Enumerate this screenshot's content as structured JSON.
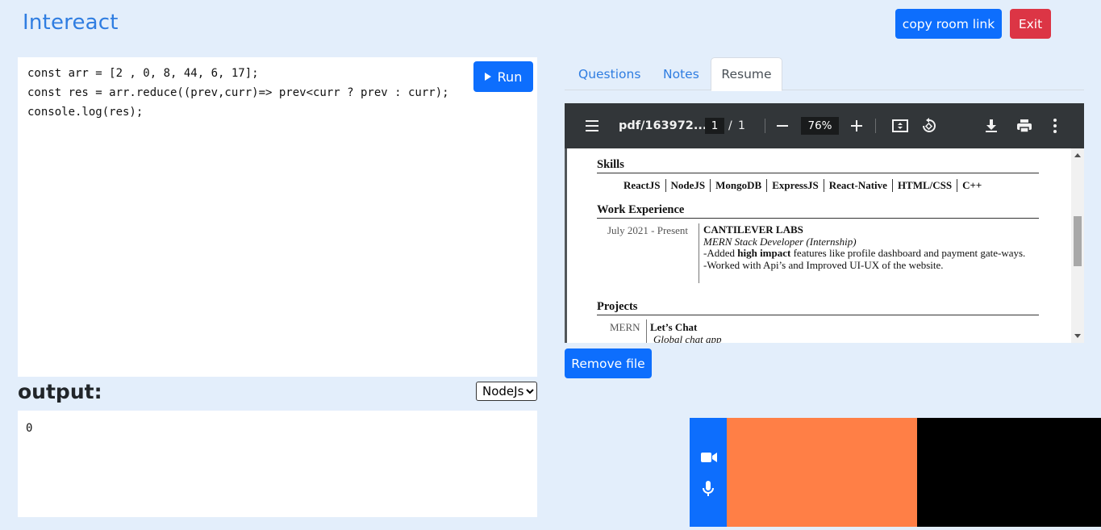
{
  "header": {
    "brand": "Intereact",
    "copy_room_link_label": "copy room link",
    "exit_label": "Exit"
  },
  "editor": {
    "code_lines": [
      "const arr = [2 , 0, 8, 44, 6, 17];",
      "const res = arr.reduce((prev,curr)=> prev<curr ? prev : curr);",
      "console.log(res);"
    ],
    "run_label": "Run"
  },
  "output": {
    "label": "output:",
    "language": "NodeJs",
    "text": "0"
  },
  "tabs": [
    {
      "label": "Questions",
      "active": false
    },
    {
      "label": "Notes",
      "active": false
    },
    {
      "label": "Resume",
      "active": true
    }
  ],
  "pdf_viewer": {
    "doc_name": "pdf/163972...",
    "page_current": "1",
    "page_separator": "/",
    "page_total": "1",
    "zoom": "76%",
    "icons": [
      "menu-icon",
      "zoom-out-icon",
      "zoom-in-icon",
      "fit-page-icon",
      "rotate-icon",
      "download-icon",
      "print-icon",
      "more-icon"
    ],
    "resume": {
      "skills_heading": "Skills",
      "skills": [
        "ReactJS",
        "NodeJS",
        "MongoDB",
        "ExpressJS",
        "React-Native",
        "HTML/CSS",
        "C++"
      ],
      "work_heading": "Work Experience",
      "work_date": "July 2021 - Present",
      "work_company": "CANTILEVER LABS",
      "work_role": "MERN Stack Developer (Internship)",
      "work_line1_prefix": "-Added ",
      "work_line1_bold": "high impact",
      "work_line1_suffix": " features like profile dashboard and payment gate-ways.",
      "work_line2": "-Worked with Api’s and Improved UI-UX of the website.",
      "projects_heading": "Projects",
      "project_tag": "MERN",
      "project_name": "Let’s Chat",
      "project_desc": "Global chat app"
    }
  },
  "remove_file_label": "Remove file",
  "video": {
    "local_color": "#ff7f46",
    "remote_color": "#000000",
    "controls_color": "#0d6efd",
    "icons": [
      "camera-icon",
      "microphone-icon"
    ]
  }
}
